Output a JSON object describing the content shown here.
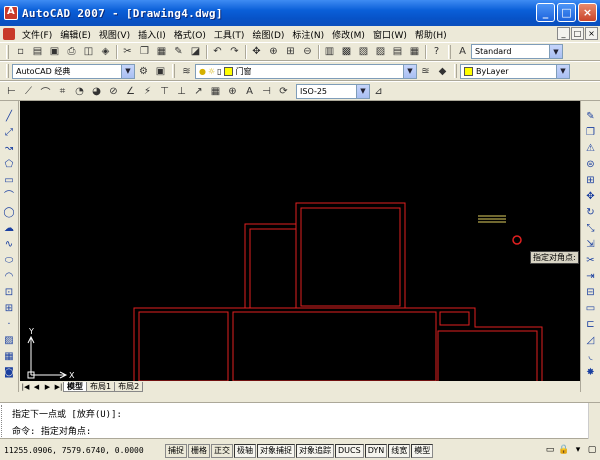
{
  "window": {
    "title": "AutoCAD 2007 - [Drawing4.dwg]",
    "controls": [
      "_",
      "□",
      "×"
    ]
  },
  "menu": {
    "items": [
      "文件(F)",
      "编辑(E)",
      "视图(V)",
      "插入(I)",
      "格式(O)",
      "工具(T)",
      "绘图(D)",
      "标注(N)",
      "修改(M)",
      "窗口(W)",
      "帮助(H)"
    ],
    "doc_controls": [
      "_",
      "□",
      "×"
    ]
  },
  "toolbar1": {
    "text_style": "Standard"
  },
  "toolbar2": {
    "workspace": "AutoCAD 经典",
    "layer_name": "门窗",
    "color": "ByLayer"
  },
  "toolbar3": {
    "dim_style": "ISO-25"
  },
  "drawing": {
    "tooltip": "指定对角点:",
    "ucs_x": "X",
    "ucs_y": "Y",
    "colors": {
      "background": "#000000",
      "lines": "#e02020",
      "grip": "#e0d060",
      "cursor": "#e02020"
    }
  },
  "layout_tabs": [
    "模型",
    "布局1",
    "布局2"
  ],
  "command": {
    "line1": "指定下一点或 [放弃(U)]:",
    "line2": "命令: 指定对角点:"
  },
  "status": {
    "coordinates": "11255.0906, 7579.6740, 0.0000",
    "buttons": [
      "捕捉",
      "栅格",
      "正交",
      "极轴",
      "对象捕捉",
      "对象追踪",
      "DUCS",
      "DYN",
      "线宽",
      "模型"
    ],
    "active": [
      "极轴",
      "对象捕捉",
      "对象追踪",
      "DUCS",
      "DYN",
      "线宽",
      "模型"
    ]
  }
}
